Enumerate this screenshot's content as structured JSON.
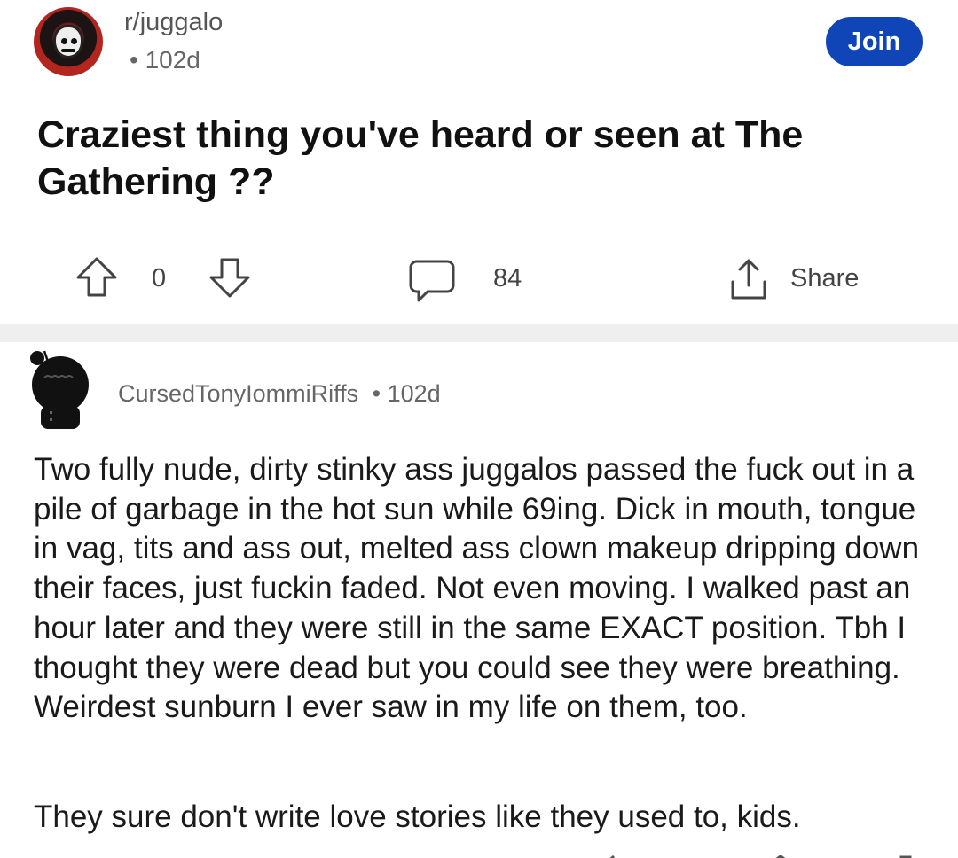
{
  "post": {
    "subreddit": "r/juggalo",
    "age": "• 102d",
    "join_label": "Join",
    "title": "Craziest thing you've heard or seen at The Gathering ??",
    "votes": "0",
    "comments": "84",
    "share_label": "Share"
  },
  "comment": {
    "author": "CursedTonyIommiRiffs",
    "age": "• 102d",
    "body": "Two fully nude, dirty stinky ass juggalos passed the fuck out in a pile of garbage in the hot sun while 69ing. Dick in mouth, tongue in vag, tits and ass out, melted ass clown makeup dripping down their faces, just fuckin faded. Not even moving. I walked past an hour later and they were still in the same EXACT position. Tbh I thought they were dead but you could see they were breathing. Weirdest sunburn I ever saw in my life on them, too.",
    "body2": "They sure don't write love stories like they used to, kids."
  },
  "colors": {
    "join_bg": "#0f45b6",
    "divider": "#efefef",
    "meta_text": "#666666"
  },
  "icons": {
    "upvote": "arrow-up-outline-icon",
    "downvote": "arrow-down-outline-icon",
    "comments": "speech-bubble-icon",
    "share": "share-upload-icon"
  }
}
